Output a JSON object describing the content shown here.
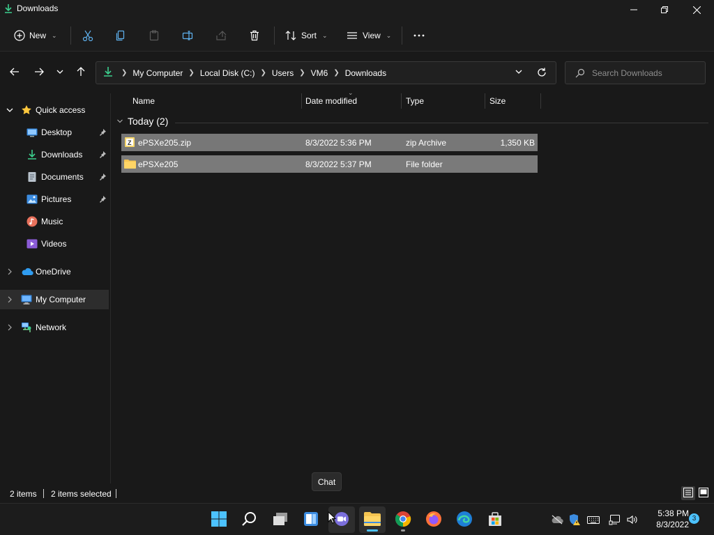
{
  "window": {
    "title": "Downloads",
    "controls": {
      "minimize": "minimize",
      "maximize": "restore",
      "close": "close"
    }
  },
  "commandbar": {
    "new_label": "New",
    "sort_label": "Sort",
    "view_label": "View",
    "more_label": "..."
  },
  "address": {
    "crumbs": [
      "My Computer",
      "Local Disk (C:)",
      "Users",
      "VM6",
      "Downloads"
    ]
  },
  "search": {
    "placeholder": "Search Downloads"
  },
  "sidebar": {
    "items": [
      {
        "label": "Quick access",
        "icon": "star-icon",
        "pinned": false,
        "expanded": true
      },
      {
        "label": "Desktop",
        "icon": "desktop-icon",
        "pinned": true
      },
      {
        "label": "Downloads",
        "icon": "download-icon",
        "pinned": true
      },
      {
        "label": "Documents",
        "icon": "document-icon",
        "pinned": true
      },
      {
        "label": "Pictures",
        "icon": "pictures-icon",
        "pinned": true
      },
      {
        "label": "Music",
        "icon": "music-icon",
        "pinned": false
      },
      {
        "label": "Videos",
        "icon": "videos-icon",
        "pinned": false
      },
      {
        "label": "OneDrive",
        "icon": "cloud-icon",
        "pinned": false,
        "expanded": false
      },
      {
        "label": "My Computer",
        "icon": "computer-icon",
        "pinned": false,
        "expanded": false,
        "selected": true
      },
      {
        "label": "Network",
        "icon": "network-icon",
        "pinned": false,
        "expanded": false
      }
    ]
  },
  "columns": {
    "name": "Name",
    "date": "Date modified",
    "type": "Type",
    "size": "Size"
  },
  "group": {
    "label": "Today (2)"
  },
  "files": [
    {
      "name": "ePSXe205.zip",
      "date": "8/3/2022 5:36 PM",
      "type": "zip Archive",
      "size": "1,350 KB",
      "icon": "zip-icon"
    },
    {
      "name": "ePSXe205",
      "date": "8/3/2022 5:37 PM",
      "type": "File folder",
      "size": "",
      "icon": "folder-icon"
    }
  ],
  "status": {
    "count": "2 items",
    "selected": "2 items selected"
  },
  "tooltip": {
    "text": "Chat"
  },
  "taskbar": {
    "time": "5:38 PM",
    "date": "8/3/2022",
    "notifications": "3"
  },
  "colors": {
    "accent": "#4cc2ff",
    "selection": "#777777",
    "folder": "#f5c451"
  }
}
